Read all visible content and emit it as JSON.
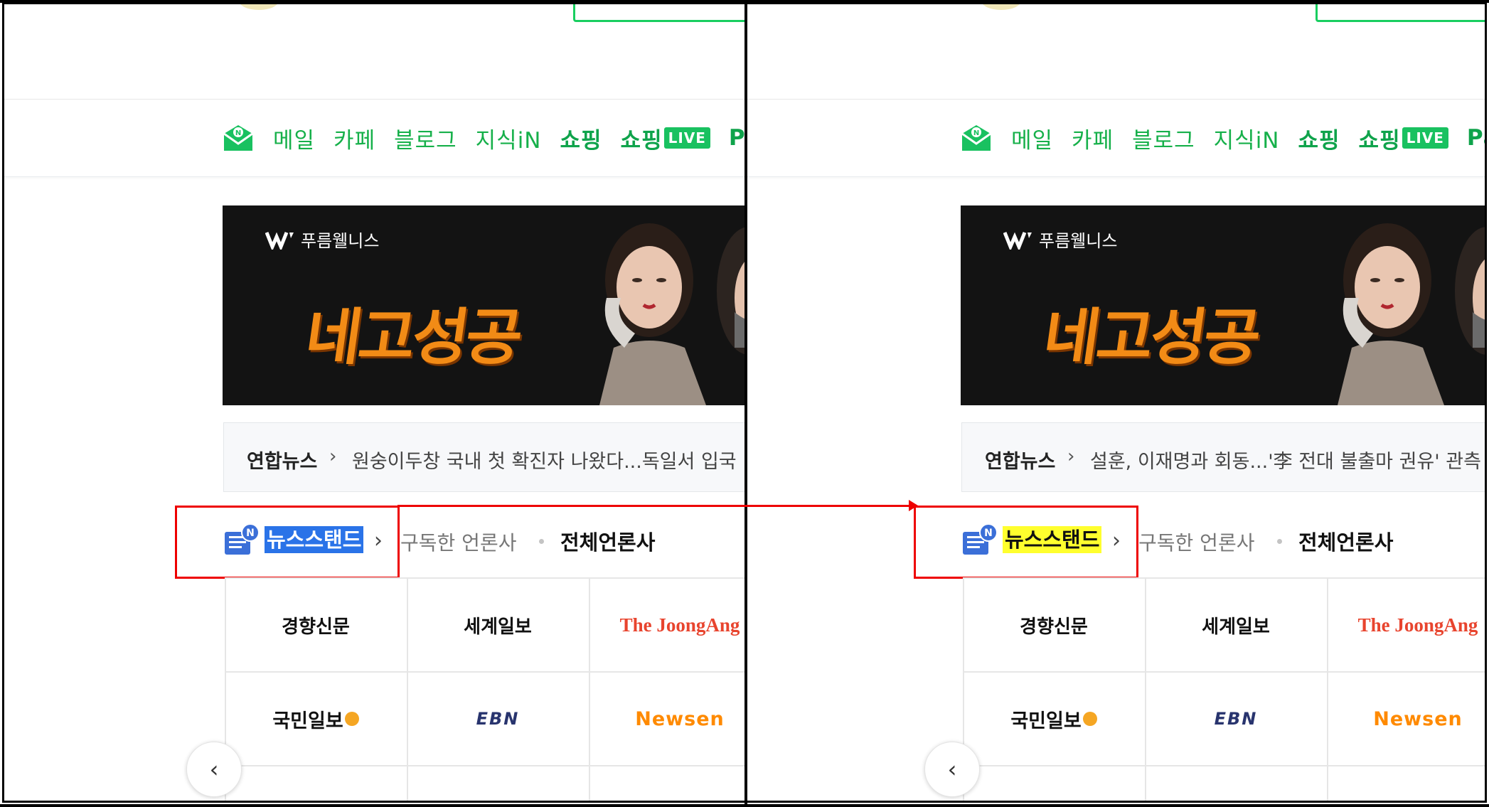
{
  "services": {
    "mail": "메일",
    "cafe": "카페",
    "blog": "블로그",
    "kin": "지식iN",
    "shopping": "쇼핑",
    "shopping_live": "쇼핑",
    "live_badge": "LIVE",
    "pay": "Pay"
  },
  "banner": {
    "brand": "푸름웰니스",
    "headline": "네고성공"
  },
  "ticker": {
    "source": "연합뉴스",
    "left_headline": "원숭이두창 국내 첫 확진자 나왔다...독일서 입국",
    "right_headline": "설훈, 이재명과 회동...'李 전대 불출마 권유' 관측"
  },
  "newsstand": {
    "title": "뉴스스탠드",
    "subscribed": "구독한 언론사",
    "all": "전체언론사"
  },
  "press": [
    {
      "name": "경향신문"
    },
    {
      "name": "세계일보"
    },
    {
      "name": "The JoongAng"
    },
    {
      "name": "국민일보"
    },
    {
      "name": "EBN"
    },
    {
      "name": "Newsen"
    }
  ],
  "colors": {
    "naver_green": "#19ce60",
    "selection_blue": "#2a73e8",
    "highlight_yellow": "#ffff2e",
    "annotation_red": "#e00000"
  },
  "icons": [
    "mail-icon",
    "newsstand-icon",
    "chevron-left-icon"
  ]
}
